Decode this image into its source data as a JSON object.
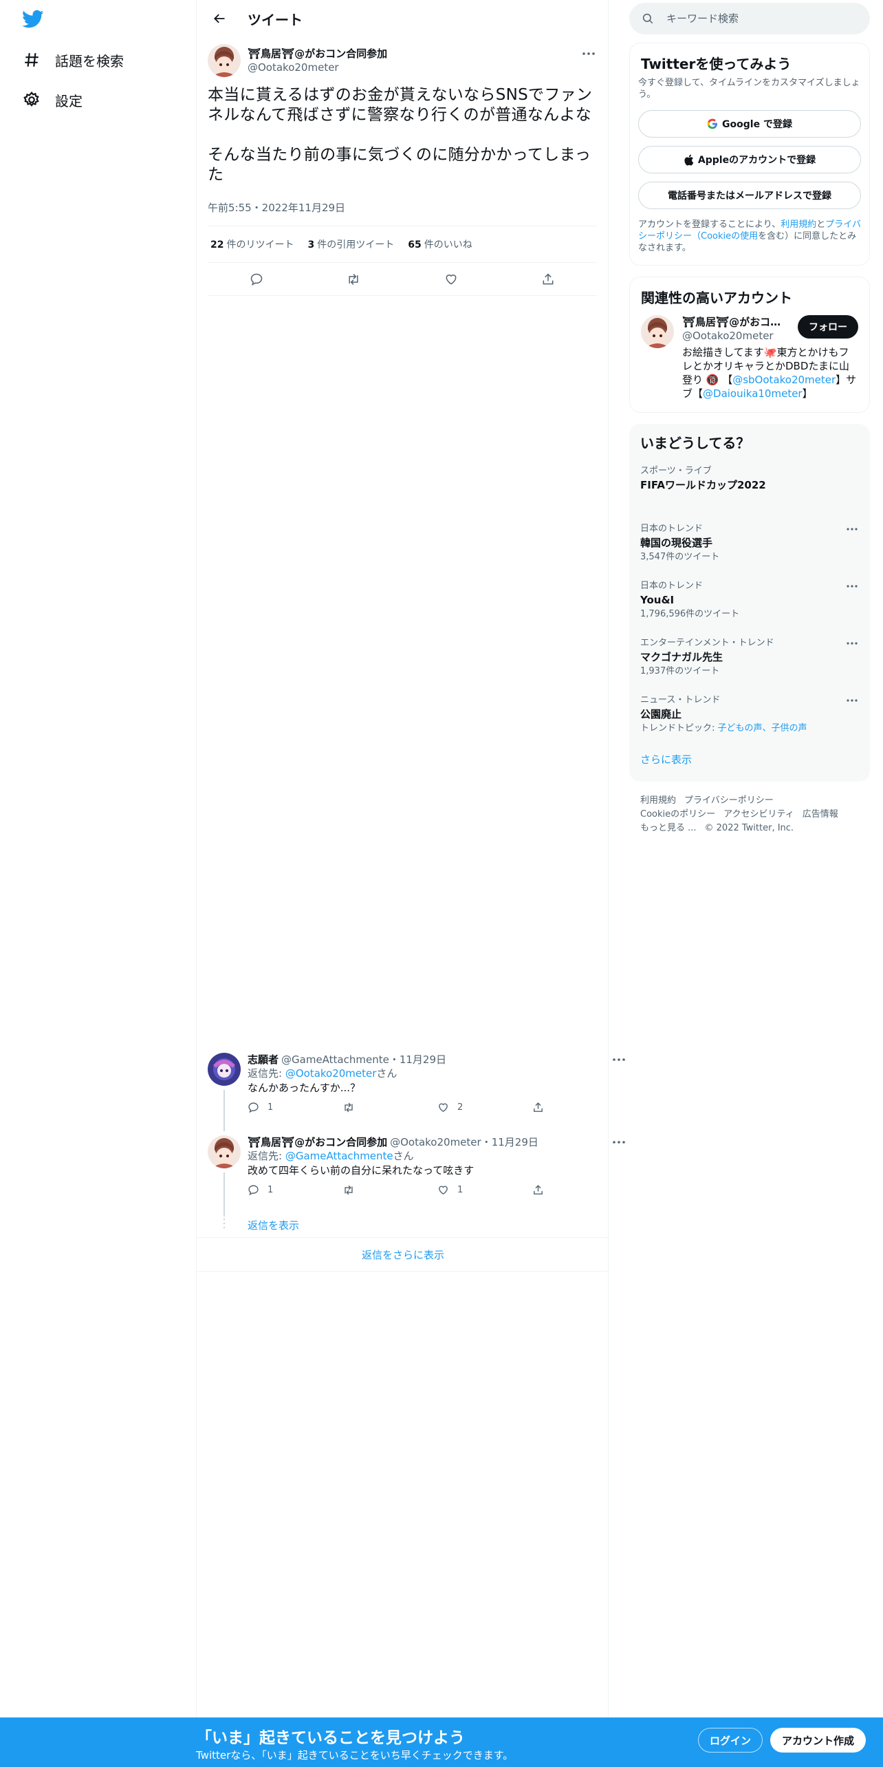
{
  "nav": {
    "explore_label": "話題を検索",
    "settings_label": "設定"
  },
  "header": {
    "title": "ツイート"
  },
  "tweet": {
    "name": "⛩鳥居⛩@がおコン合同参加",
    "handle": "@Ootako20meter",
    "text": "本当に貰えるはずのお金が貰えないならSNSでファンネルなんて飛ばさずに警察なり行くのが普通なんよな\n\nそんな当たり前の事に気づくのに随分かかってしまった",
    "time": "午前5:55・2022年11月29日",
    "retweets_count": "22",
    "retweets_label": "件のリツイート",
    "quotes_count": "3",
    "quotes_label": "件の引用ツイート",
    "likes_count": "65",
    "likes_label": "件のいいね"
  },
  "replies": [
    {
      "name": "志願者",
      "handle": "@GameAttachmente",
      "date": "・11月29日",
      "to_prefix": "返信先: ",
      "to_handle": "@Ootako20meter",
      "to_suffix": "さん",
      "text": "なんかあったんすか...？",
      "reply_count": "1",
      "retweet_count": "",
      "like_count": "2"
    },
    {
      "name": "⛩鳥居⛩@がおコン合同参加",
      "handle": "@Ootako20meter",
      "date": "・11月29日",
      "to_prefix": "返信先: ",
      "to_handle": "@GameAttachmente",
      "to_suffix": "さん",
      "text": "改めて四年くらい前の自分に呆れたなって呟きす",
      "reply_count": "1",
      "retweet_count": "",
      "like_count": "1"
    }
  ],
  "thread": {
    "show_replies": "返信を表示",
    "show_more_replies": "返信をさらに表示"
  },
  "search": {
    "placeholder": "キーワード検索"
  },
  "signup_card": {
    "title": "Twitterを使ってみよう",
    "subtitle": "今すぐ登録して、タイムラインをカスタマイズしましょう。",
    "google_label": "Google で登録",
    "apple_label": "Appleのアカウントで登録",
    "phone_label": "電話番号またはメールアドレスで登録",
    "legal_prefix": "アカウントを登録することにより、",
    "legal_terms": "利用規約",
    "legal_and": "と",
    "legal_privacy": "プライバシーポリシー",
    "legal_open": "（",
    "legal_cookie": "Cookieの使用",
    "legal_suffix": "を含む）に同意したとみなされます。"
  },
  "related": {
    "title": "関連性の高いアカウント",
    "name": "⛩鳥居⛩@がおコン合同参加",
    "handle": "@Ootako20meter",
    "follow_label": "フォロー",
    "bio_1": "お絵描きしてます🐙東方とかけもフレとかオリキャラとかDBDたまに山登り 🔞 【",
    "bio_link_1": "@sbOotako20meter",
    "bio_2": "】サブ【",
    "bio_link_2": "@Daiouika10meter",
    "bio_3": "】"
  },
  "trends": {
    "title": "いまどうしてる？",
    "items": [
      {
        "category": "スポーツ・ライブ",
        "name": "FIFAワールドカップ2022",
        "count": ""
      },
      {
        "category": "日本のトレンド",
        "name": "韓国の現役選手",
        "count": "3,547件のツイート"
      },
      {
        "category": "日本のトレンド",
        "name": "You&I",
        "count": "1,796,596件のツイート"
      },
      {
        "category": "エンターテインメント・トレンド",
        "name": "マクゴナガル先生",
        "count": "1,937件のツイート"
      },
      {
        "category": "ニュース・トレンド",
        "name": "公園廃止",
        "count": ""
      }
    ],
    "topic_prefix": "トレンドトピック: ",
    "topic_links": "子どもの声、子供の声",
    "show_more": "さらに表示"
  },
  "footer": {
    "terms": "利用規約",
    "privacy": "プライバシーポリシー",
    "cookie": "Cookieのポリシー",
    "accessibility": "アクセシビリティ",
    "ads": "広告情報",
    "more": "もっと見る ...",
    "copyright": "© 2022 Twitter, Inc."
  },
  "banner": {
    "title": "「いま」起きていることを見つけよう",
    "subtitle": "Twitterなら、「いま」起きていることをいち早くチェックできます。",
    "login_label": "ログイン",
    "signup_label": "アカウント作成"
  },
  "colors": {
    "accent": "#1d9bf0",
    "text": "#0f1419",
    "secondary": "#536471"
  }
}
